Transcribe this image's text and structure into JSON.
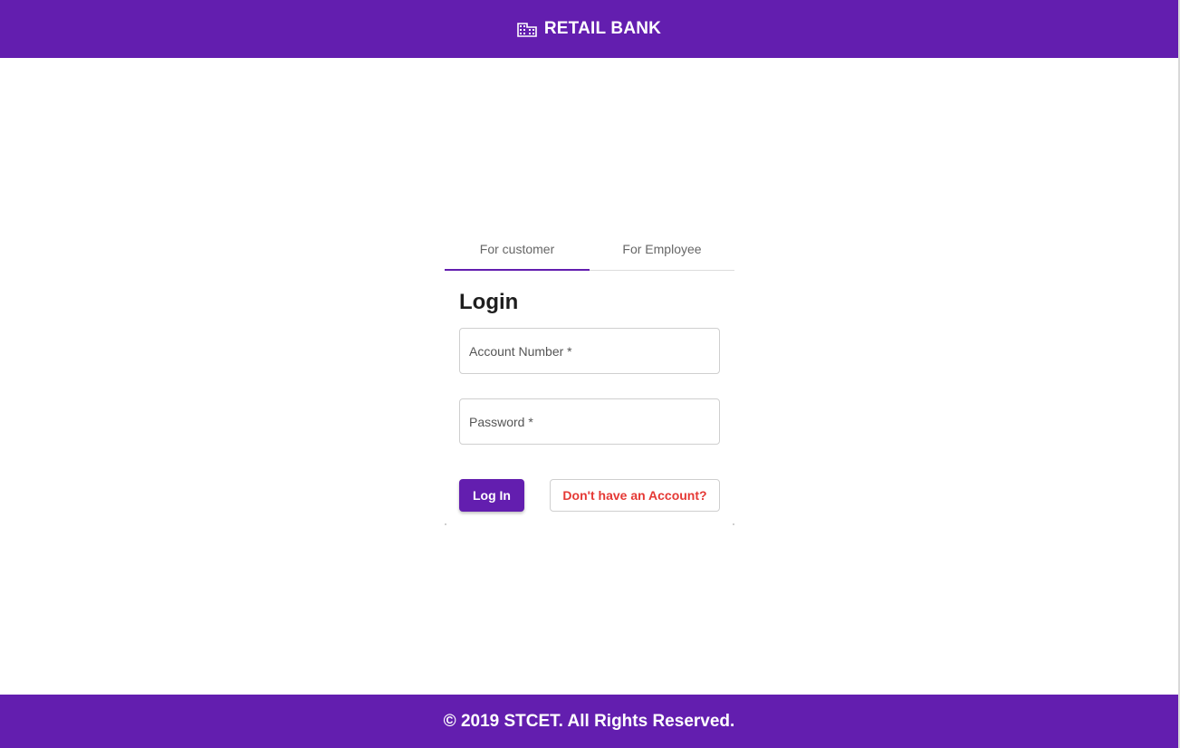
{
  "header": {
    "brand_icon": "building-icon",
    "title": "RETAIL BANK"
  },
  "tabs": [
    {
      "label": "For customer",
      "active": true
    },
    {
      "label": "For Employee",
      "active": false
    }
  ],
  "login": {
    "title": "Login",
    "account_number": {
      "placeholder": "Account Number *",
      "value": ""
    },
    "password": {
      "placeholder": "Password *",
      "value": ""
    },
    "login_button": "Log In",
    "signup_button": "Don't have an Account?"
  },
  "footer": {
    "text": "© 2019 STCET. All Rights Reserved."
  },
  "colors": {
    "primary": "#631eaf",
    "danger": "#e53935"
  }
}
